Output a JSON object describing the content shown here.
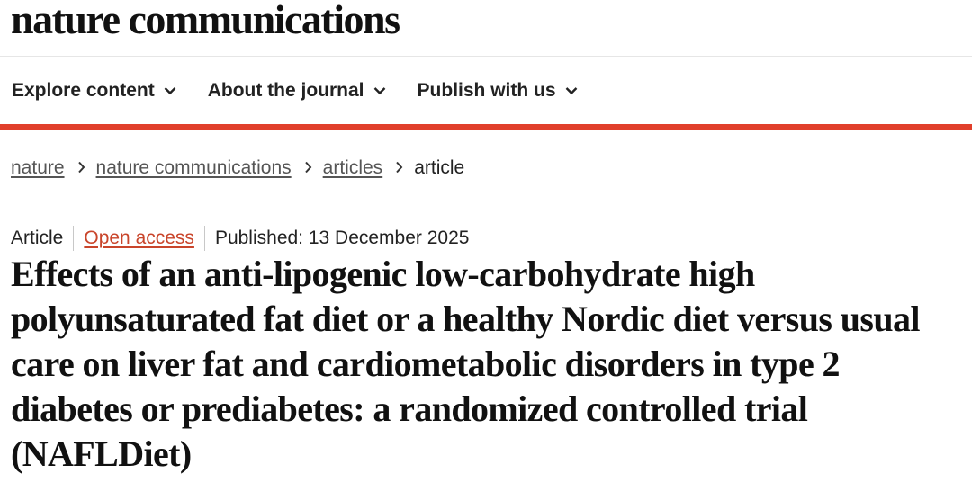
{
  "site": {
    "logo_text": "nature communications"
  },
  "nav": {
    "items": [
      {
        "label": "Explore content",
        "icon": "chevron-down-icon"
      },
      {
        "label": "About the journal",
        "icon": "chevron-down-icon"
      },
      {
        "label": "Publish with us",
        "icon": "chevron-down-icon"
      }
    ]
  },
  "colors": {
    "accent_bar": "#e13f2b",
    "open_access": "#c9452b",
    "text": "#222222"
  },
  "breadcrumb": {
    "items": [
      {
        "label": "nature"
      },
      {
        "label": "nature communications"
      },
      {
        "label": "articles"
      }
    ],
    "current": "article",
    "separator_icon": "chevron-right-icon"
  },
  "article": {
    "type": "Article",
    "access": "Open access",
    "published": "Published: 13 December 2025",
    "title": "Effects of an anti-lipogenic low-carbohydrate high polyunsaturated fat diet or a healthy Nordic diet versus usual care on liver fat and cardiometabolic disorders in type 2 diabetes or prediabetes: a randomized controlled trial (NAFLDiet)"
  }
}
